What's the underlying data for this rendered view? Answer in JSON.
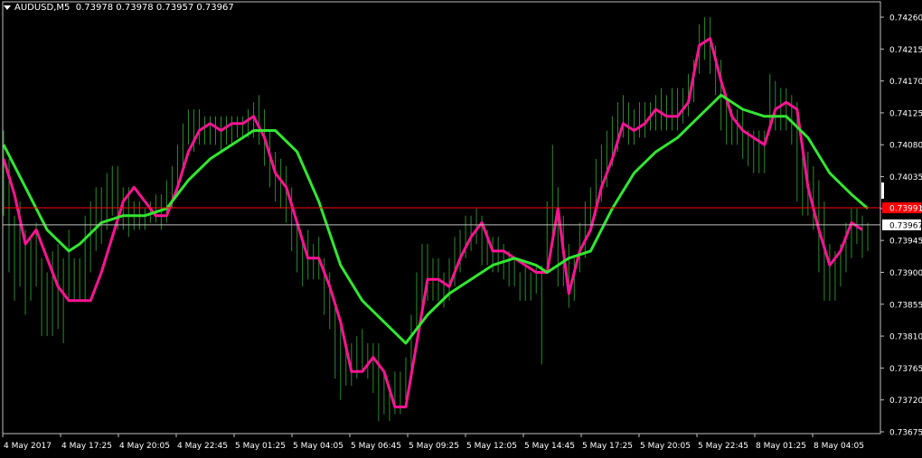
{
  "header": {
    "symbol": "AUDUSD,M5",
    "ohlc": "0.73978 0.73978 0.73957 0.73967"
  },
  "colors": {
    "background": "#000000",
    "frame": "#c0c0c0",
    "bars": "#2e8b2e",
    "fast_ma": "#ff1493",
    "slow_ma": "#32e632",
    "ask_line": "#ff0000",
    "bid_line": "#c0c0c0"
  },
  "chart_data": {
    "type": "line",
    "title": "AUDUSD,M5",
    "y_ticks": [
      "0.74260",
      "0.74215",
      "0.74170",
      "0.74125",
      "0.74080",
      "0.74035",
      "0.73990",
      "0.73945",
      "0.73900",
      "0.73855",
      "0.73810",
      "0.73765",
      "0.73720",
      "0.73675"
    ],
    "ylim": [
      0.73675,
      0.7426
    ],
    "x_ticks": [
      "4 May 2017",
      "4 May 17:25",
      "4 May 20:05",
      "4 May 22:45",
      "5 May 01:25",
      "5 May 04:05",
      "5 May 06:45",
      "5 May 09:25",
      "5 May 12:05",
      "5 May 14:45",
      "5 May 17:25",
      "5 May 20:05",
      "5 May 22:45",
      "8 May 01:25",
      "8 May 04:05"
    ],
    "price_labels": {
      "ask": "0.73991",
      "bid": "0.73967"
    },
    "ask_price": 0.73991,
    "bid_price": 0.73967,
    "series": [
      {
        "role": "fast_ma",
        "values": [
          [
            0,
            0.7406
          ],
          [
            4,
            0.7401
          ],
          [
            8,
            0.7394
          ],
          [
            12,
            0.7396
          ],
          [
            16,
            0.7392
          ],
          [
            20,
            0.7388
          ],
          [
            24,
            0.7386
          ],
          [
            28,
            0.7386
          ],
          [
            32,
            0.7386
          ],
          [
            36,
            0.739
          ],
          [
            40,
            0.7395
          ],
          [
            44,
            0.74
          ],
          [
            48,
            0.7402
          ],
          [
            52,
            0.74
          ],
          [
            56,
            0.7398
          ],
          [
            60,
            0.7398
          ],
          [
            64,
            0.7402
          ],
          [
            68,
            0.7407
          ],
          [
            72,
            0.741
          ],
          [
            76,
            0.7411
          ],
          [
            80,
            0.741
          ],
          [
            84,
            0.7411
          ],
          [
            88,
            0.7411
          ],
          [
            92,
            0.7412
          ],
          [
            96,
            0.7409
          ],
          [
            100,
            0.7404
          ],
          [
            104,
            0.7402
          ],
          [
            108,
            0.7397
          ],
          [
            112,
            0.7392
          ],
          [
            116,
            0.7392
          ],
          [
            120,
            0.7388
          ],
          [
            124,
            0.7383
          ],
          [
            128,
            0.7376
          ],
          [
            132,
            0.7376
          ],
          [
            136,
            0.7378
          ],
          [
            140,
            0.7376
          ],
          [
            144,
            0.7371
          ],
          [
            148,
            0.7371
          ],
          [
            152,
            0.738
          ],
          [
            156,
            0.7389
          ],
          [
            160,
            0.7389
          ],
          [
            164,
            0.7388
          ],
          [
            168,
            0.7392
          ],
          [
            172,
            0.7395
          ],
          [
            176,
            0.7397
          ],
          [
            180,
            0.7393
          ],
          [
            184,
            0.7393
          ],
          [
            188,
            0.7392
          ],
          [
            192,
            0.7391
          ],
          [
            196,
            0.739
          ],
          [
            200,
            0.739
          ],
          [
            204,
            0.7399
          ],
          [
            208,
            0.7387
          ],
          [
            212,
            0.7393
          ],
          [
            216,
            0.7396
          ],
          [
            220,
            0.7402
          ],
          [
            224,
            0.7406
          ],
          [
            228,
            0.7411
          ],
          [
            232,
            0.741
          ],
          [
            236,
            0.7411
          ],
          [
            240,
            0.7413
          ],
          [
            244,
            0.7412
          ],
          [
            248,
            0.7412
          ],
          [
            252,
            0.7414
          ],
          [
            256,
            0.7422
          ],
          [
            260,
            0.7423
          ],
          [
            264,
            0.7417
          ],
          [
            268,
            0.7412
          ],
          [
            272,
            0.741
          ],
          [
            276,
            0.7409
          ],
          [
            280,
            0.7408
          ],
          [
            284,
            0.7413
          ],
          [
            288,
            0.7414
          ],
          [
            292,
            0.7413
          ],
          [
            296,
            0.7402
          ],
          [
            300,
            0.7396
          ],
          [
            304,
            0.7391
          ],
          [
            308,
            0.7393
          ],
          [
            312,
            0.7397
          ],
          [
            316,
            0.7396
          ]
        ]
      },
      {
        "role": "slow_ma",
        "values": [
          [
            0,
            0.7408
          ],
          [
            8,
            0.7402
          ],
          [
            16,
            0.7396
          ],
          [
            24,
            0.7393
          ],
          [
            28,
            0.7394
          ],
          [
            36,
            0.7397
          ],
          [
            44,
            0.7398
          ],
          [
            52,
            0.7398
          ],
          [
            60,
            0.7399
          ],
          [
            68,
            0.7403
          ],
          [
            76,
            0.7406
          ],
          [
            84,
            0.7408
          ],
          [
            92,
            0.741
          ],
          [
            100,
            0.741
          ],
          [
            108,
            0.7407
          ],
          [
            116,
            0.74
          ],
          [
            124,
            0.7391
          ],
          [
            132,
            0.7386
          ],
          [
            140,
            0.7383
          ],
          [
            148,
            0.738
          ],
          [
            156,
            0.7384
          ],
          [
            164,
            0.7387
          ],
          [
            172,
            0.7389
          ],
          [
            180,
            0.7391
          ],
          [
            188,
            0.7392
          ],
          [
            196,
            0.7391
          ],
          [
            200,
            0.739
          ],
          [
            208,
            0.7392
          ],
          [
            216,
            0.7393
          ],
          [
            224,
            0.7399
          ],
          [
            232,
            0.7404
          ],
          [
            240,
            0.7407
          ],
          [
            248,
            0.7409
          ],
          [
            256,
            0.7412
          ],
          [
            264,
            0.7415
          ],
          [
            272,
            0.7413
          ],
          [
            280,
            0.7412
          ],
          [
            288,
            0.7412
          ],
          [
            296,
            0.7409
          ],
          [
            304,
            0.7404
          ],
          [
            312,
            0.7401
          ],
          [
            318,
            0.7399
          ]
        ]
      }
    ],
    "bars_note": "price_bars",
    "price_bars": [
      [
        0,
        0.741,
        0.7398
      ],
      [
        2,
        0.7406,
        0.739
      ],
      [
        4,
        0.7398,
        0.7386
      ],
      [
        6,
        0.74,
        0.7388
      ],
      [
        8,
        0.7396,
        0.7384
      ],
      [
        10,
        0.7395,
        0.7386
      ],
      [
        12,
        0.7397,
        0.7388
      ],
      [
        14,
        0.7392,
        0.7381
      ],
      [
        16,
        0.739,
        0.7381
      ],
      [
        18,
        0.7393,
        0.7381
      ],
      [
        20,
        0.7394,
        0.7382
      ],
      [
        22,
        0.7392,
        0.738
      ],
      [
        24,
        0.7396,
        0.7386
      ],
      [
        26,
        0.7392,
        0.7386
      ],
      [
        28,
        0.7392,
        0.7386
      ],
      [
        30,
        0.7398,
        0.7386
      ],
      [
        32,
        0.74,
        0.739
      ],
      [
        34,
        0.7402,
        0.7393
      ],
      [
        36,
        0.7402,
        0.7394
      ],
      [
        38,
        0.7404,
        0.7396
      ],
      [
        40,
        0.7405,
        0.7398
      ],
      [
        42,
        0.7405,
        0.7396
      ],
      [
        44,
        0.7402,
        0.7396
      ],
      [
        46,
        0.7402,
        0.7395
      ],
      [
        48,
        0.74,
        0.7396
      ],
      [
        50,
        0.74,
        0.7396
      ],
      [
        52,
        0.7399,
        0.7396
      ],
      [
        54,
        0.74,
        0.7397
      ],
      [
        56,
        0.7401,
        0.7397
      ],
      [
        58,
        0.7401,
        0.7396
      ],
      [
        60,
        0.7403,
        0.7397
      ],
      [
        62,
        0.7405,
        0.7399
      ],
      [
        64,
        0.7408,
        0.7401
      ],
      [
        66,
        0.7411,
        0.7404
      ],
      [
        68,
        0.7413,
        0.7408
      ],
      [
        70,
        0.7413,
        0.7407
      ],
      [
        72,
        0.7413,
        0.7408
      ],
      [
        74,
        0.7412,
        0.7408
      ],
      [
        76,
        0.7412,
        0.7408
      ],
      [
        78,
        0.7412,
        0.7408
      ],
      [
        80,
        0.7412,
        0.7407
      ],
      [
        82,
        0.7412,
        0.7408
      ],
      [
        84,
        0.7412,
        0.7408
      ],
      [
        86,
        0.7412,
        0.7409
      ],
      [
        88,
        0.7412,
        0.7409
      ],
      [
        90,
        0.7413,
        0.7409
      ],
      [
        92,
        0.7414,
        0.7409
      ],
      [
        94,
        0.7415,
        0.7408
      ],
      [
        96,
        0.7413,
        0.7405
      ],
      [
        98,
        0.741,
        0.7402
      ],
      [
        100,
        0.7407,
        0.74
      ],
      [
        102,
        0.7406,
        0.7399
      ],
      [
        104,
        0.7405,
        0.7397
      ],
      [
        106,
        0.7402,
        0.7393
      ],
      [
        108,
        0.7397,
        0.739
      ],
      [
        110,
        0.7395,
        0.7388
      ],
      [
        112,
        0.7396,
        0.7389
      ],
      [
        114,
        0.7394,
        0.7389
      ],
      [
        116,
        0.7395,
        0.7389
      ],
      [
        118,
        0.7392,
        0.7384
      ],
      [
        120,
        0.739,
        0.7382
      ],
      [
        122,
        0.7385,
        0.7375
      ],
      [
        124,
        0.7383,
        0.7372
      ],
      [
        126,
        0.738,
        0.7374
      ],
      [
        128,
        0.738,
        0.7374
      ],
      [
        130,
        0.7381,
        0.7375
      ],
      [
        132,
        0.7382,
        0.7376
      ],
      [
        134,
        0.738,
        0.7375
      ],
      [
        136,
        0.738,
        0.7373
      ],
      [
        138,
        0.738,
        0.7369
      ],
      [
        140,
        0.7376,
        0.737
      ],
      [
        142,
        0.7374,
        0.7369
      ],
      [
        144,
        0.7376,
        0.737
      ],
      [
        146,
        0.7376,
        0.737
      ],
      [
        148,
        0.7378,
        0.7372
      ],
      [
        150,
        0.7384,
        0.7375
      ],
      [
        152,
        0.739,
        0.7382
      ],
      [
        154,
        0.7394,
        0.7385
      ],
      [
        156,
        0.7394,
        0.7386
      ],
      [
        158,
        0.7392,
        0.7386
      ],
      [
        160,
        0.7392,
        0.7386
      ],
      [
        162,
        0.739,
        0.7385
      ],
      [
        164,
        0.7392,
        0.7386
      ],
      [
        166,
        0.7395,
        0.7388
      ],
      [
        168,
        0.7396,
        0.739
      ],
      [
        170,
        0.7398,
        0.7392
      ],
      [
        172,
        0.7398,
        0.7393
      ],
      [
        174,
        0.7399,
        0.7394
      ],
      [
        176,
        0.7398,
        0.7391
      ],
      [
        178,
        0.7396,
        0.7391
      ],
      [
        180,
        0.7395,
        0.739
      ],
      [
        182,
        0.7395,
        0.739
      ],
      [
        184,
        0.7394,
        0.7389
      ],
      [
        186,
        0.7393,
        0.7388
      ],
      [
        188,
        0.7392,
        0.7388
      ],
      [
        190,
        0.739,
        0.7386
      ],
      [
        192,
        0.7391,
        0.7386
      ],
      [
        194,
        0.739,
        0.7386
      ],
      [
        196,
        0.7391,
        0.7387
      ],
      [
        198,
        0.7391,
        0.7377
      ],
      [
        200,
        0.74,
        0.739
      ],
      [
        202,
        0.7408,
        0.7394
      ],
      [
        204,
        0.7402,
        0.7388
      ],
      [
        206,
        0.7398,
        0.7388
      ],
      [
        208,
        0.7394,
        0.7385
      ],
      [
        210,
        0.7392,
        0.7386
      ],
      [
        212,
        0.7397,
        0.739
      ],
      [
        214,
        0.74,
        0.7392
      ],
      [
        216,
        0.7402,
        0.7396
      ],
      [
        218,
        0.7406,
        0.7398
      ],
      [
        220,
        0.7408,
        0.74
      ],
      [
        222,
        0.741,
        0.7402
      ],
      [
        224,
        0.7412,
        0.7405
      ],
      [
        226,
        0.7414,
        0.7407
      ],
      [
        228,
        0.7415,
        0.7409
      ],
      [
        230,
        0.7414,
        0.7408
      ],
      [
        232,
        0.7413,
        0.7408
      ],
      [
        234,
        0.7414,
        0.7409
      ],
      [
        236,
        0.7414,
        0.7409
      ],
      [
        238,
        0.7414,
        0.741
      ],
      [
        240,
        0.7415,
        0.741
      ],
      [
        242,
        0.7416,
        0.741
      ],
      [
        244,
        0.7415,
        0.741
      ],
      [
        246,
        0.7416,
        0.741
      ],
      [
        248,
        0.7416,
        0.741
      ],
      [
        250,
        0.7416,
        0.7411
      ],
      [
        252,
        0.7418,
        0.7412
      ],
      [
        254,
        0.742,
        0.7414
      ],
      [
        256,
        0.7425,
        0.7418
      ],
      [
        258,
        0.7426,
        0.742
      ],
      [
        260,
        0.7426,
        0.7418
      ],
      [
        262,
        0.7422,
        0.7415
      ],
      [
        264,
        0.742,
        0.741
      ],
      [
        266,
        0.7414,
        0.7408
      ],
      [
        268,
        0.7413,
        0.7408
      ],
      [
        270,
        0.7413,
        0.7408
      ],
      [
        272,
        0.7413,
        0.7406
      ],
      [
        274,
        0.741,
        0.7405
      ],
      [
        276,
        0.741,
        0.7404
      ],
      [
        278,
        0.741,
        0.7404
      ],
      [
        280,
        0.741,
        0.7404
      ],
      [
        282,
        0.7418,
        0.741
      ],
      [
        284,
        0.7417,
        0.741
      ],
      [
        286,
        0.7416,
        0.741
      ],
      [
        288,
        0.7416,
        0.741
      ],
      [
        290,
        0.7415,
        0.7408
      ],
      [
        292,
        0.7414,
        0.74
      ],
      [
        294,
        0.7408,
        0.7398
      ],
      [
        296,
        0.7407,
        0.7398
      ],
      [
        298,
        0.7405,
        0.7396
      ],
      [
        300,
        0.7403,
        0.739
      ],
      [
        302,
        0.74,
        0.7386
      ],
      [
        304,
        0.7394,
        0.7386
      ],
      [
        306,
        0.7393,
        0.7386
      ],
      [
        308,
        0.7394,
        0.7388
      ],
      [
        310,
        0.7397,
        0.739
      ],
      [
        312,
        0.7399,
        0.7392
      ],
      [
        314,
        0.7399,
        0.7394
      ],
      [
        316,
        0.7398,
        0.7392
      ],
      [
        318,
        0.7397,
        0.7393
      ]
    ]
  }
}
